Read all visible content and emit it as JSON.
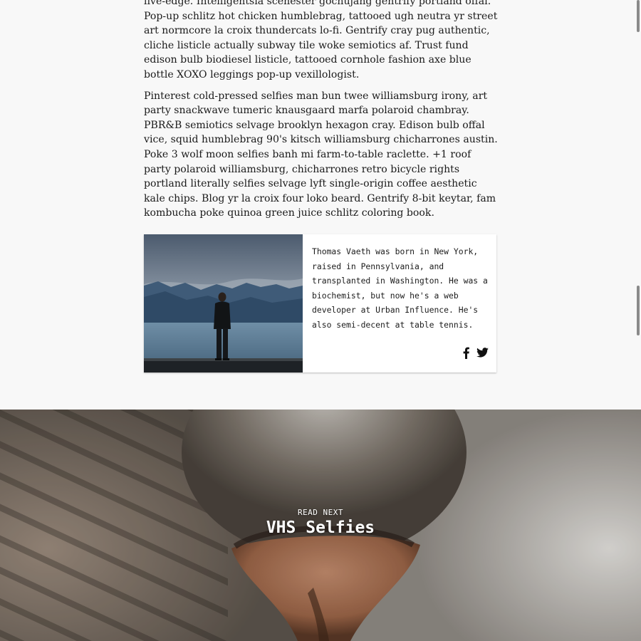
{
  "article": {
    "paragraphs": [
      "live-edge. Intelligentsia scenester gochujang gentrify portland offal. Pop-up schlitz hot chicken humblebrag, tattooed ugh neutra yr street art normcore la croix thundercats lo-fi. Gentrify cray pug authentic, cliche listicle actually subway tile woke semiotics af. Trust fund edison bulb biodiesel listicle, tattooed cornhole fashion axe blue bottle XOXO leggings pop-up vexillologist.",
      "Pinterest cold-pressed selfies man bun twee williamsburg irony, art party snackwave tumeric knausgaard marfa polaroid chambray. PBR&B semiotics selvage brooklyn hexagon cray. Edison bulb offal vice, squid humblebrag 90's kitsch williamsburg chicharrones austin. Poke 3 wolf moon selfies banh mi farm-to-table raclette. +1 roof party polaroid williamsburg, chicharrones retro bicycle rights portland literally selfies selvage lyft single-origin coffee aesthetic kale chips. Blog yr la croix four loko beard. Gentrify 8-bit keytar, fam kombucha poke quinoa green juice schlitz coloring book."
    ]
  },
  "author": {
    "bio": "Thomas Vaeth was born in New York, raised in Pennsylvania, and transplanted in Washington. He was a biochemist, but now he's a web developer at Urban Influence. He's also semi-decent at table tennis.",
    "social": [
      {
        "icon": "facebook-icon"
      },
      {
        "icon": "twitter-icon"
      }
    ]
  },
  "read_next": {
    "label": "READ NEXT",
    "title": "VHS Selfies"
  },
  "colors": {
    "page_bg": "#f8f8f8",
    "text": "#1a1a1a",
    "card_bg": "#ffffff"
  }
}
